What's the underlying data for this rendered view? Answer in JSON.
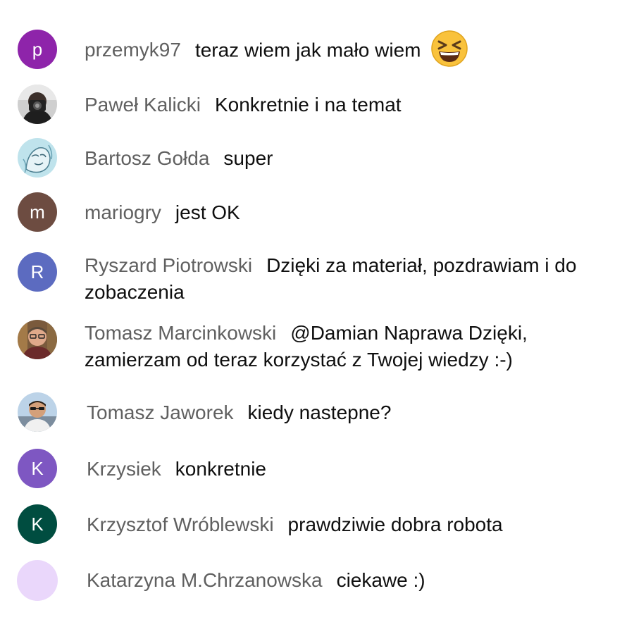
{
  "messages": [
    {
      "author": "przemyk97",
      "text": "teraz wiem jak mało wiem",
      "avatar": {
        "type": "letter",
        "letter": "p",
        "color": "#8e24aa"
      },
      "emoji": "grinning-squinting-face"
    },
    {
      "author": "Paweł Kalicki",
      "text": "Konkretnie i na temat",
      "avatar": {
        "type": "photo",
        "icon": "camera-person-photo"
      }
    },
    {
      "author": "Bartosz Gołda",
      "text": "super",
      "avatar": {
        "type": "photo",
        "icon": "sketch-portrait-photo"
      }
    },
    {
      "author": "mariogry",
      "text": "jest OK",
      "avatar": {
        "type": "letter",
        "letter": "m",
        "color": "#6d4c41"
      }
    },
    {
      "author": "Ryszard Piotrowski",
      "text": "Dzięki za materiał, pozdrawiam i do zobaczenia",
      "avatar": {
        "type": "letter",
        "letter": "R",
        "color": "#5c6bc0"
      }
    },
    {
      "author": "Tomasz Marcinkowski",
      "text": "@Damian Naprawa Dzięki, zamierzam od teraz korzystać z Twojej wiedzy :-)",
      "avatar": {
        "type": "photo",
        "icon": "man-glasses-photo"
      }
    },
    {
      "author": "Tomasz Jaworek",
      "text": "kiedy nastepne?",
      "avatar": {
        "type": "photo",
        "icon": "man-sunglasses-photo"
      }
    },
    {
      "author": "Krzysiek",
      "text": "konkretnie",
      "avatar": {
        "type": "letter",
        "letter": "K",
        "color": "#7e57c2"
      }
    },
    {
      "author": "Krzysztof Wróblewski",
      "text": "prawdziwie dobra robota",
      "avatar": {
        "type": "letter",
        "letter": "K",
        "color": "#004d40"
      }
    },
    {
      "author": "Katarzyna M.Chrzanowska",
      "text": "ciekawe :)",
      "avatar": {
        "type": "blank",
        "color": "#ead7fb"
      }
    }
  ]
}
